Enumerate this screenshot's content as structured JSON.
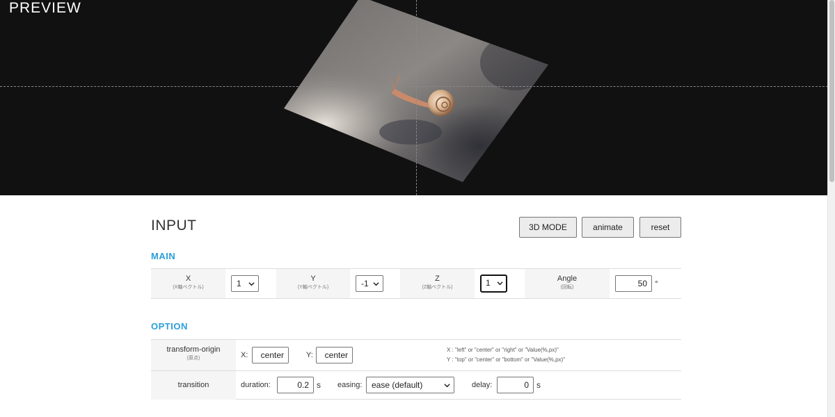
{
  "preview": {
    "title": "PREVIEW"
  },
  "input": {
    "title": "INPUT",
    "buttons": {
      "mode_3d": "3D MODE",
      "animate": "animate",
      "reset": "reset"
    }
  },
  "main": {
    "label": "MAIN",
    "x": {
      "label": "X",
      "sub": "(X軸ベクトル)",
      "value": "1"
    },
    "y": {
      "label": "Y",
      "sub": "(Y軸ベクトル)",
      "value": "-1"
    },
    "z": {
      "label": "Z",
      "sub": "(Z軸ベクトル)",
      "value": "1"
    },
    "angle": {
      "label": "Angle",
      "sub": "(回転)",
      "value": "50",
      "unit": "°"
    }
  },
  "option": {
    "label": "OPTION",
    "transform_origin": {
      "label": "transform-origin",
      "sub": "(原点)",
      "x_label": "X:",
      "x_value": "center",
      "y_label": "Y:",
      "y_value": "center",
      "hint_x": "X : \"left\" or \"center\" or \"right\" or \"Value(%,px)\"",
      "hint_y": "Y : \"top\" or \"center\" or \"bottom\" or \"Value(%,px)\""
    },
    "transition": {
      "label": "transition",
      "duration_label": "duration:",
      "duration_value": "0.2",
      "duration_unit": "s",
      "easing_label": "easing:",
      "easing_value": "ease (default)",
      "delay_label": "delay:",
      "delay_value": "0",
      "delay_unit": "s"
    }
  },
  "colors": {
    "preview_bg": "#121112",
    "accent": "#2a9fd8"
  }
}
